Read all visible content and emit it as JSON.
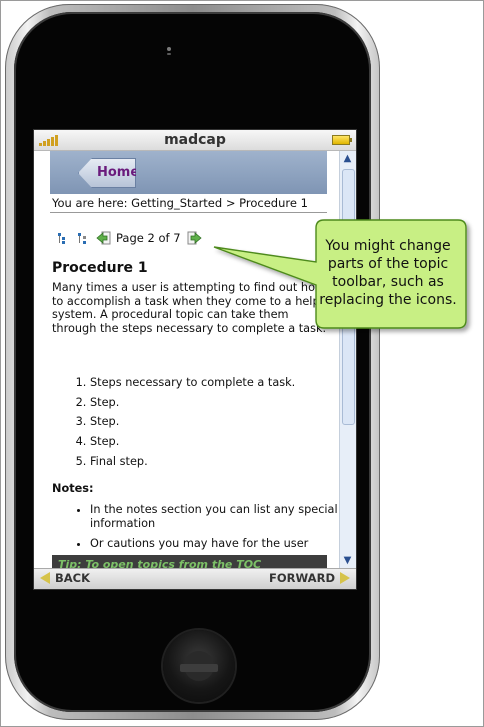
{
  "status_bar": {
    "carrier": "madcap"
  },
  "header": {
    "home_label": "Home"
  },
  "breadcrumb": "You are here: Getting_Started > Procedure 1",
  "toolbar": {
    "page_indicator": "Page 2 of 7"
  },
  "topic": {
    "title": "Procedure 1",
    "intro": "Many times a user is attempting to find out how to accomplish a task when they come to a help system. A procedural topic can take them through the steps necessary to complete a task.",
    "steps": [
      "Steps necessary to complete a task.",
      "Step.",
      "Step.",
      "Step.",
      "Final step."
    ],
    "notes_heading": "Notes:",
    "notes": [
      "In the notes section you can list any special information",
      "Or cautions you may have for the user"
    ],
    "tip": "Tip: To open topics from the TOC"
  },
  "navbar": {
    "back_label": "BACK",
    "forward_label": "FORWARD"
  },
  "callout": {
    "text": "You might change parts of the topic toolbar, such as replacing the icons."
  },
  "colors": {
    "callout_fill": "#c8ef84",
    "home_label": "#6a1b7c",
    "tip_text": "#7cc067",
    "header_band": "#8ea3c0"
  },
  "icons": [
    "signal-icon",
    "battery-icon",
    "toc-collapse-icon",
    "toc-expand-icon",
    "previous-topic-icon",
    "next-topic-icon",
    "scroll-up-icon",
    "scroll-down-icon",
    "back-arrow-icon",
    "forward-arrow-icon"
  ]
}
